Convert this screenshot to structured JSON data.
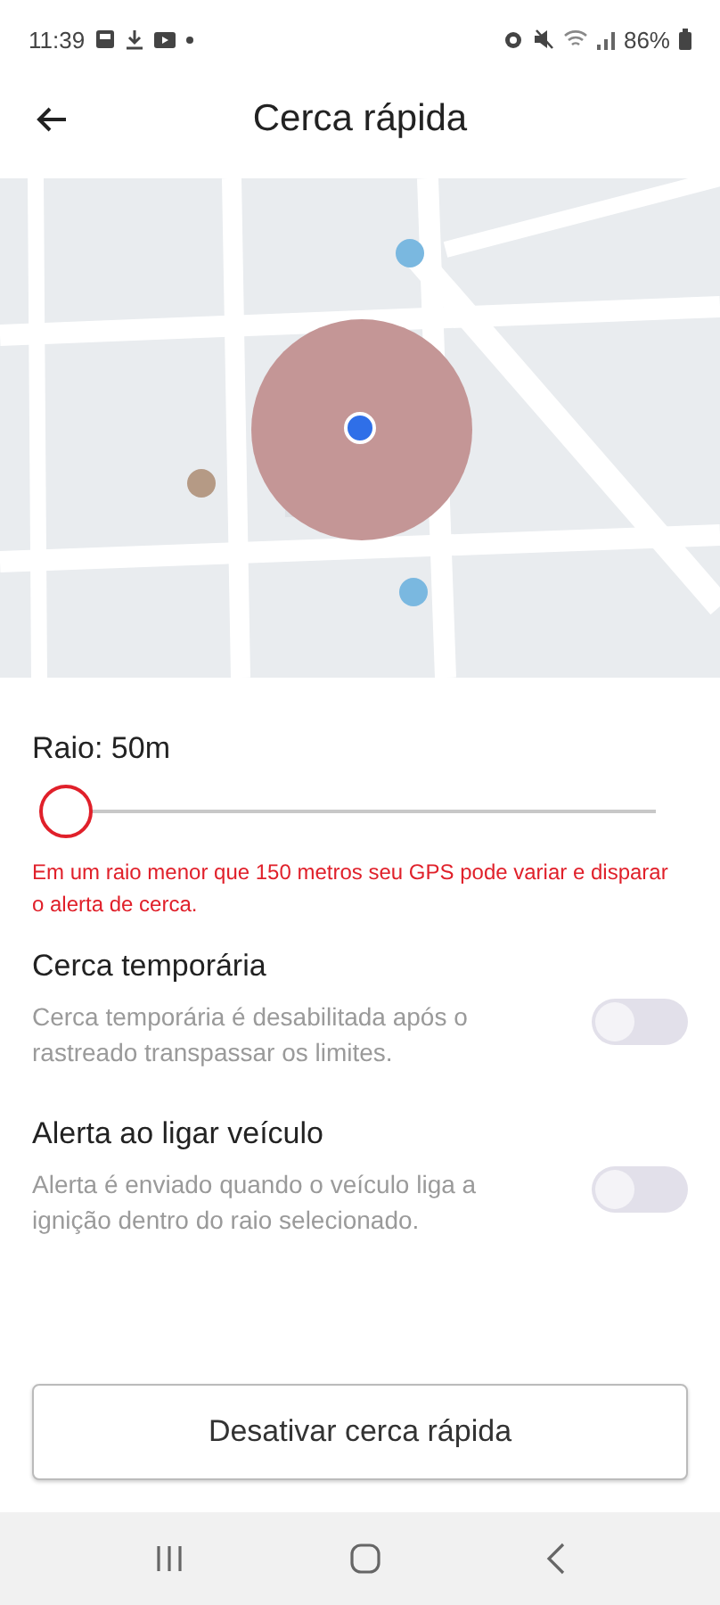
{
  "status_bar": {
    "time": "11:39",
    "battery": "86%"
  },
  "header": {
    "title": "Cerca rápida"
  },
  "radius": {
    "label": "Raio: 50m",
    "level": 0
  },
  "warning": "Em um raio menor que 150 metros seu GPS pode variar e disparar o alerta de cerca.",
  "settings": [
    {
      "title": "Cerca temporária",
      "description": "Cerca temporária é desabilitada após o rastreado transpassar os limites.",
      "on": false
    },
    {
      "title": "Alerta ao ligar veículo",
      "description": "Alerta é enviado quando o veículo liga a ignição dentro do raio selecionado.",
      "on": false
    }
  ],
  "button": "Desativar cerca rápida"
}
